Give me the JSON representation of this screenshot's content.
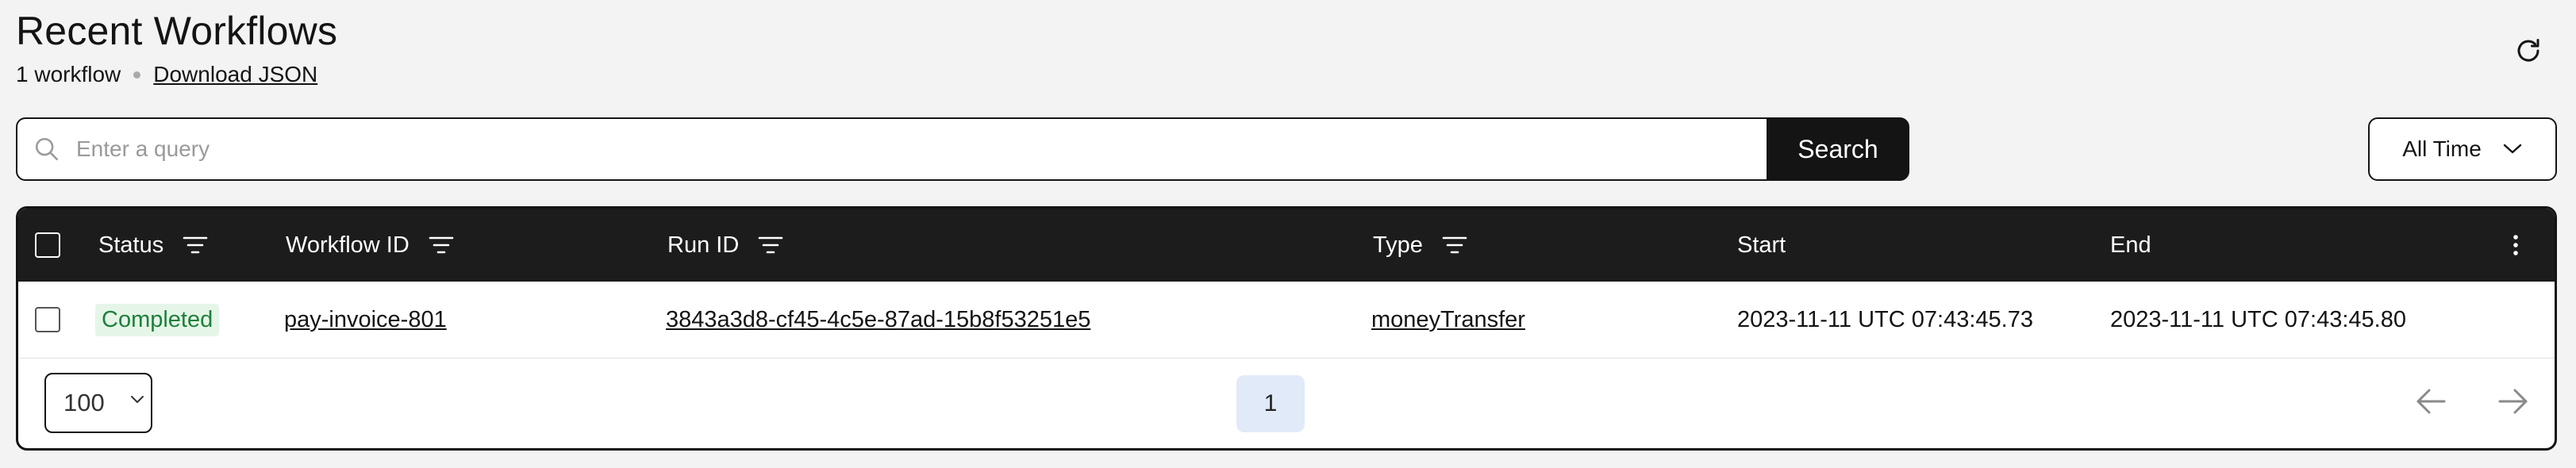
{
  "header": {
    "title": "Recent Workflows",
    "count_label": "1 workflow",
    "download_label": "Download JSON",
    "refresh_icon": "refresh-icon"
  },
  "search": {
    "placeholder": "Enter a query",
    "value": "",
    "button_label": "Search",
    "icon": "search-icon"
  },
  "time_filter": {
    "selected": "All Time"
  },
  "table": {
    "columns": [
      {
        "label": "Status",
        "filterable": true
      },
      {
        "label": "Workflow ID",
        "filterable": true
      },
      {
        "label": "Run ID",
        "filterable": true
      },
      {
        "label": "Type",
        "filterable": true
      },
      {
        "label": "Start",
        "filterable": false
      },
      {
        "label": "End",
        "filterable": false
      }
    ],
    "rows": [
      {
        "status": "Completed",
        "workflow_id": "pay-invoice-801",
        "run_id": "3843a3d8-cf45-4c5e-87ad-15b8f53251e5",
        "type": "moneyTransfer",
        "start": "2023-11-11 UTC 07:43:45.73",
        "end": "2023-11-11 UTC 07:43:45.80"
      }
    ]
  },
  "pagination": {
    "per_page": "100",
    "current_page": "1"
  },
  "colors": {
    "header_bg": "#1c1c1c",
    "status_completed_bg": "#e5f6e8",
    "status_completed_text": "#1e7f3a",
    "page_active_bg": "#e1eaf9"
  }
}
